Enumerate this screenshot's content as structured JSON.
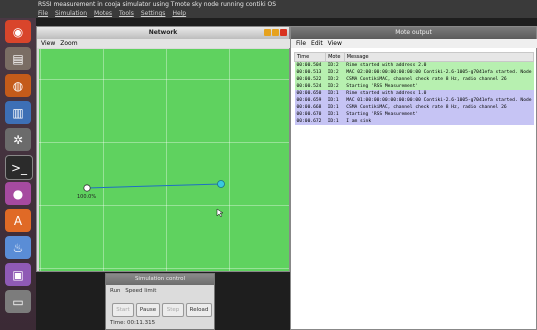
{
  "topbar": {
    "title": "RSSI measurement in cooja simulator using Tmote sky node running contiki OS",
    "menus": [
      "File",
      "Simulation",
      "Motes",
      "Tools",
      "Settings",
      "Help"
    ]
  },
  "network": {
    "title": "Network",
    "menus": [
      "View",
      "Zoom"
    ],
    "mote_label": "100.0%"
  },
  "mote_output": {
    "title": "Mote output",
    "menus": [
      "File",
      "Edit",
      "View"
    ],
    "columns": [
      "Time",
      "Mote",
      "Message"
    ],
    "rows": [
      {
        "time": "00:00.504",
        "mote": "ID:2",
        "msg": "Rime started with address 2.0",
        "color": "g"
      },
      {
        "time": "00:00.513",
        "mote": "ID:2",
        "msg": "MAC 02:00:00:00:00:00:00:00 Contiki-2.6-1005-g7041efa started. Node",
        "color": "g"
      },
      {
        "time": "00:00.522",
        "mote": "ID:2",
        "msg": "CSMA ContikiMAC, channel check rate 8 Hz, radio channel 26",
        "color": "g"
      },
      {
        "time": "00:00.524",
        "mote": "ID:2",
        "msg": "Starting 'RSS Measurement'",
        "color": "g"
      },
      {
        "time": "00:00.650",
        "mote": "ID:1",
        "msg": "Rime started with address 1.0",
        "color": "p"
      },
      {
        "time": "00:00.659",
        "mote": "ID:1",
        "msg": "MAC 01:00:00:00:00:00:00:00 Contiki-2.6-1005-g7041efa started. Node",
        "color": "p"
      },
      {
        "time": "00:00.668",
        "mote": "ID:1",
        "msg": "CSMA ContikiMAC, channel check rate 8 Hz, radio channel 26",
        "color": "p"
      },
      {
        "time": "00:00.670",
        "mote": "ID:1",
        "msg": "Starting 'RSS Measurement'",
        "color": "p"
      },
      {
        "time": "00:00.672",
        "mote": "ID:1",
        "msg": "I am sink",
        "color": "p"
      }
    ]
  },
  "sim_control": {
    "title": "Simulation control",
    "run_label": "Run",
    "speed_label": "Speed limit",
    "buttons": [
      "Start",
      "Pause",
      "Step",
      "Reload"
    ],
    "time": "Time: 00:11.315"
  }
}
